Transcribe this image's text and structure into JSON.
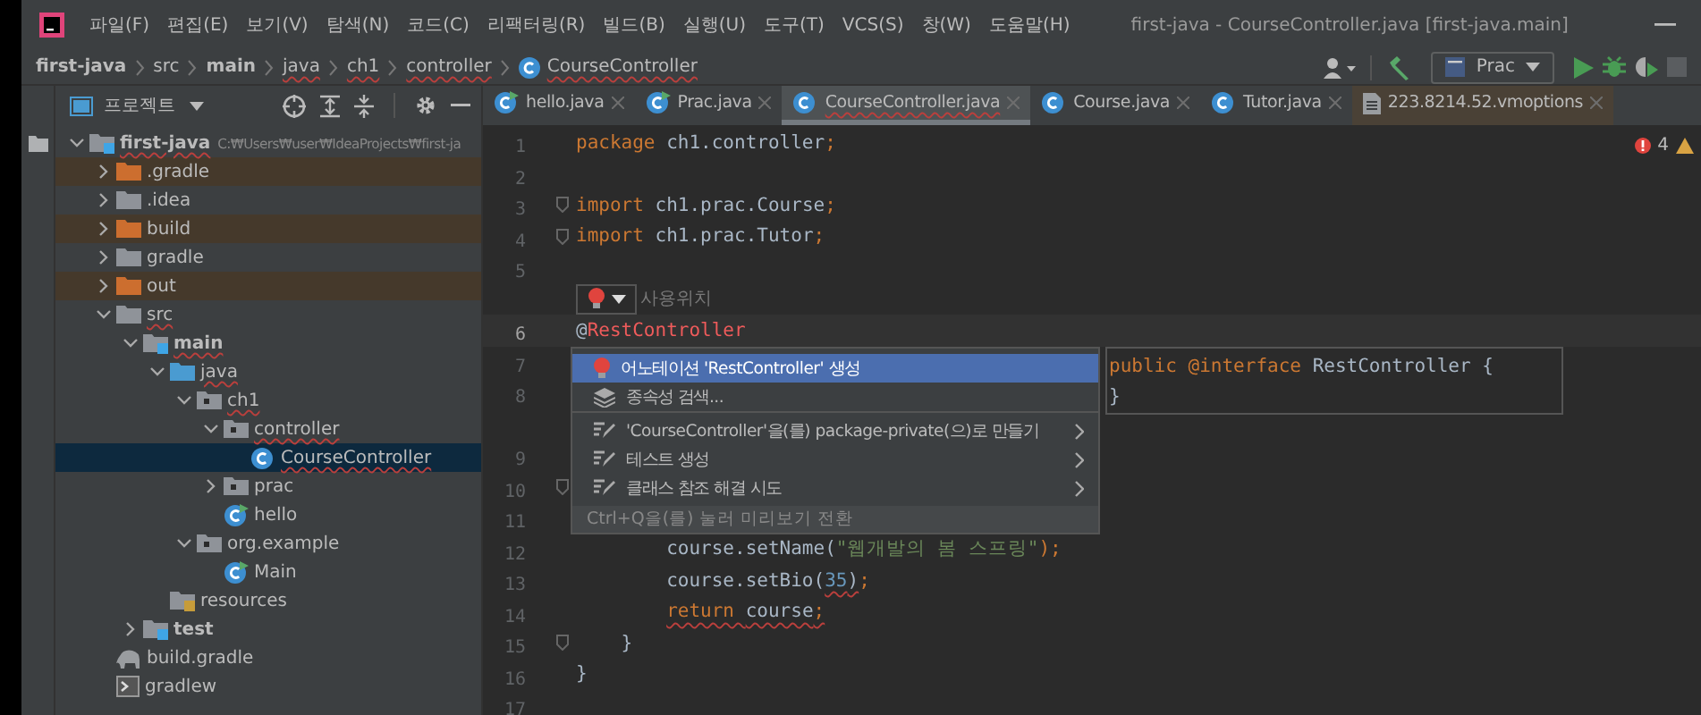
{
  "menu_bar": {
    "items": [
      "파일(F)",
      "편집(E)",
      "보기(V)",
      "탐색(N)",
      "코드(C)",
      "리팩터링(R)",
      "빌드(B)",
      "실행(U)",
      "도구(T)",
      "VCS(S)",
      "창(W)",
      "도움말(H)"
    ],
    "window_title": "first-java - CourseController.java [first-java.main]"
  },
  "breadcrumb": [
    {
      "label": "first-java",
      "kind": "folder",
      "bold": true,
      "error": false
    },
    {
      "label": "src",
      "kind": "folder",
      "bold": false,
      "error": false
    },
    {
      "label": "main",
      "kind": "folder",
      "bold": true,
      "error": false
    },
    {
      "label": "java",
      "kind": "folder",
      "bold": false,
      "error": true
    },
    {
      "label": "ch1",
      "kind": "folder",
      "bold": false,
      "error": true
    },
    {
      "label": "controller",
      "kind": "folder",
      "bold": false,
      "error": true
    },
    {
      "label": "CourseController",
      "kind": "class",
      "bold": false,
      "error": true
    }
  ],
  "toolbar": {
    "run_config": "Prac"
  },
  "project_panel": {
    "title": "프로젝트",
    "tree": [
      {
        "label": "first-java",
        "path": "C:₩Users₩user₩IdeaProjects₩first-ja",
        "kind": "module",
        "bold": true,
        "error": true,
        "selected": false,
        "expanded": true,
        "children": [
          {
            "label": ".gradle",
            "kind": "excluded",
            "bold": false,
            "error": false,
            "selected": false,
            "expanded": false
          },
          {
            "label": ".idea",
            "kind": "folder",
            "bold": false,
            "error": false,
            "selected": false,
            "expanded": false
          },
          {
            "label": "build",
            "kind": "excluded",
            "bold": false,
            "error": false,
            "selected": false,
            "expanded": false
          },
          {
            "label": "gradle",
            "kind": "folder",
            "bold": false,
            "error": false,
            "selected": false,
            "expanded": false
          },
          {
            "label": "out",
            "kind": "excluded",
            "bold": false,
            "error": false,
            "selected": false,
            "expanded": false
          },
          {
            "label": "src",
            "kind": "folder",
            "bold": false,
            "error": true,
            "selected": false,
            "expanded": true,
            "children": [
              {
                "label": "main",
                "kind": "module",
                "bold": true,
                "error": true,
                "selected": false,
                "expanded": true,
                "children": [
                  {
                    "label": "java",
                    "kind": "source",
                    "bold": false,
                    "error": true,
                    "selected": false,
                    "expanded": true,
                    "children": [
                      {
                        "label": "ch1",
                        "kind": "package",
                        "bold": false,
                        "error": true,
                        "selected": false,
                        "expanded": true,
                        "children": [
                          {
                            "label": "controller",
                            "kind": "package",
                            "bold": false,
                            "error": true,
                            "selected": false,
                            "expanded": true,
                            "children": [
                              {
                                "label": "CourseController",
                                "kind": "class",
                                "bold": false,
                                "error": true,
                                "selected": true
                              }
                            ]
                          },
                          {
                            "label": "prac",
                            "kind": "package",
                            "bold": false,
                            "error": false,
                            "selected": false,
                            "expanded": false
                          },
                          {
                            "label": "hello",
                            "kind": "runnable",
                            "bold": false,
                            "error": false,
                            "selected": false
                          }
                        ]
                      },
                      {
                        "label": "org.example",
                        "kind": "package",
                        "bold": false,
                        "error": false,
                        "selected": false,
                        "expanded": true,
                        "children": [
                          {
                            "label": "Main",
                            "kind": "runnable",
                            "bold": false,
                            "error": false,
                            "selected": false
                          }
                        ]
                      }
                    ]
                  },
                  {
                    "label": "resources",
                    "kind": "resources",
                    "bold": false,
                    "error": false,
                    "selected": false
                  }
                ]
              },
              {
                "label": "test",
                "kind": "module",
                "bold": true,
                "error": false,
                "selected": false,
                "expanded": false
              }
            ]
          },
          {
            "label": "build.gradle",
            "kind": "gradle",
            "bold": false,
            "error": false,
            "selected": false
          },
          {
            "label": "gradlew",
            "kind": "script",
            "bold": false,
            "error": false,
            "selected": false
          }
        ]
      }
    ]
  },
  "tabs": [
    {
      "label": "hello.java",
      "kind": "runnable",
      "selected": false,
      "external": false
    },
    {
      "label": "Prac.java",
      "kind": "runnable",
      "selected": false,
      "external": false
    },
    {
      "label": "CourseController.java",
      "kind": "class",
      "selected": true,
      "external": false
    },
    {
      "label": "Course.java",
      "kind": "class",
      "selected": false,
      "external": false
    },
    {
      "label": "Tutor.java",
      "kind": "class",
      "selected": false,
      "external": false
    },
    {
      "label": "223.8214.52.vmoptions",
      "kind": "file",
      "selected": false,
      "external": true
    }
  ],
  "editor": {
    "problems": {
      "errors": "4"
    },
    "lines": [
      {
        "kind": "code",
        "num": "1",
        "fold": false,
        "current": false,
        "tokens": [
          {
            "t": "package ",
            "kind": "kw"
          },
          {
            "t": "ch1.controller",
            "kind": "id"
          },
          {
            "t": ";",
            "kind": "kw"
          }
        ]
      },
      {
        "kind": "code",
        "num": "2",
        "fold": false,
        "current": false
      },
      {
        "kind": "code",
        "num": "3",
        "fold": true,
        "current": false,
        "tokens": [
          {
            "t": "import ",
            "kind": "kw"
          },
          {
            "t": "ch1.prac.Course",
            "kind": "id"
          },
          {
            "t": ";",
            "kind": "kw"
          }
        ]
      },
      {
        "kind": "code",
        "num": "4",
        "fold": true,
        "current": false,
        "tokens": [
          {
            "t": "import ",
            "kind": "kw"
          },
          {
            "t": "ch1.prac.Tutor",
            "kind": "id"
          },
          {
            "t": ";",
            "kind": "kw"
          }
        ]
      },
      {
        "kind": "code",
        "num": "5",
        "fold": false,
        "current": false
      },
      {
        "kind": "hint",
        "text": "사용위치"
      },
      {
        "kind": "code",
        "num": "6",
        "fold": false,
        "current": true,
        "tokens": [
          {
            "t": "@",
            "kind": "id"
          },
          {
            "t": "RestController",
            "kind": "unresolved"
          }
        ]
      },
      {
        "kind": "code",
        "num": "7",
        "fold": false,
        "current": false
      },
      {
        "kind": "code",
        "num": "8",
        "fold": false,
        "current": false
      },
      {
        "kind": "blank"
      },
      {
        "kind": "code",
        "num": "9",
        "fold": false,
        "current": false
      },
      {
        "kind": "code",
        "num": "10",
        "fold": true,
        "current": false
      },
      {
        "kind": "code",
        "num": "11",
        "fold": false,
        "current": false
      },
      {
        "kind": "code",
        "num": "12",
        "fold": false,
        "current": false,
        "tokens": [
          {
            "t": "        course.setName(",
            "kind": "id",
            "err": false
          },
          {
            "t": "\"웹개발의 봄 스프링\"",
            "kind": "str",
            "err": false
          },
          {
            "t": ");",
            "kind": "kw",
            "err": false
          }
        ]
      },
      {
        "kind": "code",
        "num": "13",
        "fold": false,
        "current": false,
        "tokens": [
          {
            "t": "        course.setBio(",
            "kind": "id",
            "err": false
          },
          {
            "t": "35",
            "kind": "num",
            "err": true
          },
          {
            "t": ")",
            "kind": "id",
            "err": true
          },
          {
            "t": ";",
            "kind": "kw",
            "err": false
          }
        ]
      },
      {
        "kind": "code",
        "num": "14",
        "fold": false,
        "current": false,
        "tokens": [
          {
            "t": "        return ",
            "kind": "kw",
            "err": true
          },
          {
            "t": "course",
            "kind": "id",
            "err": true
          },
          {
            "t": ";",
            "kind": "kw",
            "err": true
          }
        ]
      },
      {
        "kind": "code",
        "num": "15",
        "fold": true,
        "current": false,
        "tokens": [
          {
            "t": "    }",
            "kind": "id",
            "err": false
          }
        ]
      },
      {
        "kind": "code",
        "num": "16",
        "fold": false,
        "current": false,
        "tokens": [
          {
            "t": "}",
            "kind": "id",
            "err": false
          }
        ]
      },
      {
        "kind": "code",
        "num": "17",
        "fold": false,
        "current": false
      }
    ],
    "intention_popup": {
      "items": [
        {
          "label": "어노테이션 'RestController' 생성",
          "kind": "bulb",
          "selected": true,
          "submenu": false,
          "divider_before": false
        },
        {
          "label": "종속성 검색...",
          "kind": "layers",
          "selected": false,
          "submenu": false,
          "divider_before": false
        },
        {
          "label": "'CourseController'을(를) package-private(으)로 만들기",
          "kind": "edit",
          "selected": false,
          "submenu": true,
          "divider_before": true
        },
        {
          "label": "테스트 생성",
          "kind": "edit",
          "selected": false,
          "submenu": true,
          "divider_before": false
        },
        {
          "label": "클래스 참조 해결 시도",
          "kind": "edit",
          "selected": false,
          "submenu": true,
          "divider_before": false
        }
      ],
      "footer": "Ctrl+Q을(를) 눌러 미리보기 전환"
    },
    "preview": {
      "lines": [
        [
          {
            "t": "public ",
            "kind": "kw"
          },
          {
            "t": "@interface ",
            "kind": "kw"
          },
          {
            "t": "RestController {",
            "kind": "id"
          }
        ],
        [
          {
            "t": "}",
            "kind": "id"
          }
        ]
      ]
    }
  }
}
